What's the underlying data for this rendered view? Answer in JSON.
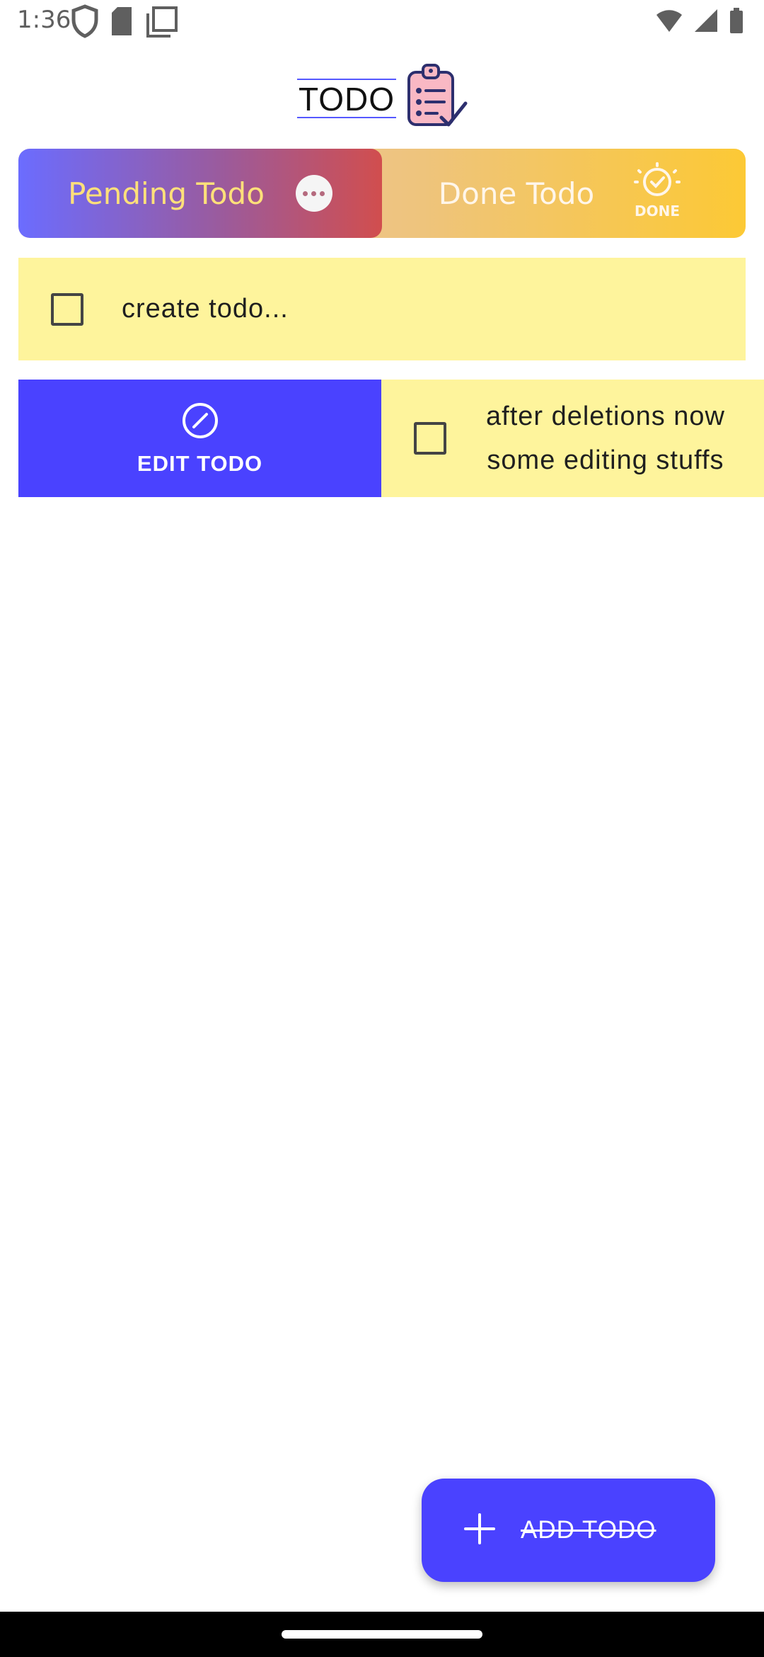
{
  "status_bar": {
    "time": "1:36",
    "left_icons": [
      "shield-icon",
      "sd-card-icon",
      "copy-icon"
    ],
    "right_icons": [
      "wifi-icon",
      "signal-icon",
      "battery-icon"
    ]
  },
  "header": {
    "logo_text": "TODO",
    "logo_icon": "clipboard-list-icon"
  },
  "tabs": [
    {
      "label": "Pending Todo",
      "icon": "more-dots-icon",
      "selected": true
    },
    {
      "label": "Done Todo",
      "icon": "done-badge-icon",
      "selected": false,
      "badge_text": "DONE"
    }
  ],
  "todos": [
    {
      "text": "create todo...",
      "checked": false
    },
    {
      "text": "after deletions now\nsome editing stuffs",
      "checked": false,
      "swiped": true
    }
  ],
  "swipe_action": {
    "label": "EDIT TODO",
    "icon": "edit-circle-icon"
  },
  "fab": {
    "label": "ADD TODO",
    "icon": "plus-icon"
  },
  "colors": {
    "accent": "#4a42ff",
    "todo_background": "#fef49c",
    "pending_tab_start": "#6b6cff",
    "pending_tab_end": "#d14e4e",
    "done_tab_end": "#fcc935"
  }
}
